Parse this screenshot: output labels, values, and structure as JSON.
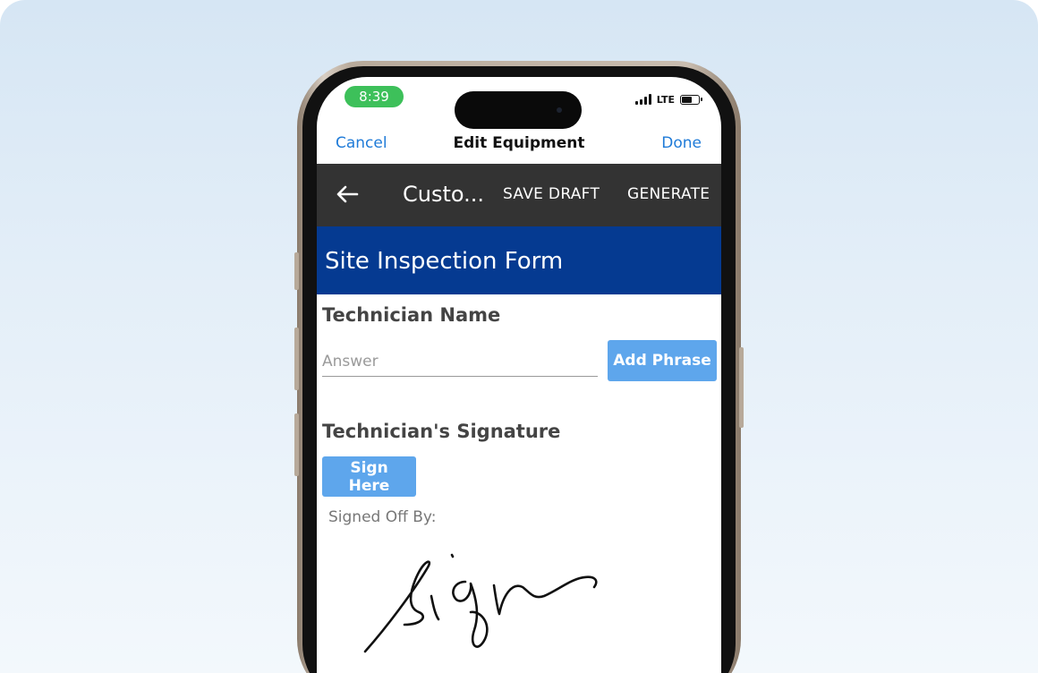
{
  "status_bar": {
    "time": "8:39",
    "network": "LTE",
    "battery_level": 0.55,
    "colors": {
      "time_pill": "#3dc05a"
    }
  },
  "ios_nav": {
    "cancel_label": "Cancel",
    "title": "Edit Equipment",
    "done_label": "Done",
    "colors": {
      "link": "#1f7bd8"
    }
  },
  "toolbar": {
    "back_icon": "arrow-left-icon",
    "title": "Custo...",
    "save_draft_label": "SAVE DRAFT",
    "generate_label": "GENERATE",
    "colors": {
      "background": "#333333",
      "text": "#ffffff"
    }
  },
  "form": {
    "title": "Site Inspection Form",
    "colors": {
      "header": "#053a91",
      "button": "#5ea6ec"
    },
    "technician_name": {
      "label": "Technician Name",
      "placeholder": "Answer",
      "value": "",
      "add_phrase_label": "Add Phrase"
    },
    "signature": {
      "label": "Technician's Signature",
      "sign_button_label": "Sign Here",
      "signed_off_label": "Signed Off By:"
    }
  }
}
